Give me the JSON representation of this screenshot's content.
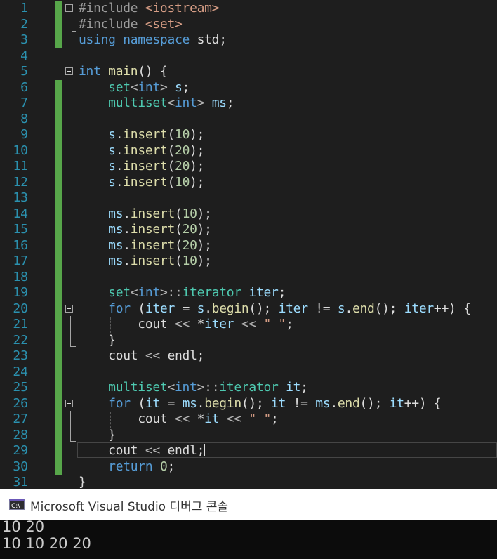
{
  "editor": {
    "line_numbers": [
      "1",
      "2",
      "3",
      "4",
      "5",
      "6",
      "7",
      "8",
      "9",
      "10",
      "11",
      "12",
      "13",
      "14",
      "15",
      "16",
      "17",
      "18",
      "19",
      "20",
      "21",
      "22",
      "23",
      "24",
      "25",
      "26",
      "27",
      "28",
      "29",
      "30",
      "31"
    ],
    "lines": [
      [
        {
          "c": "pp",
          "t": "#include "
        },
        {
          "c": "inc",
          "t": "<iostream>"
        }
      ],
      [
        {
          "c": "pp",
          "t": "#include "
        },
        {
          "c": "inc",
          "t": "<set>"
        }
      ],
      [
        {
          "c": "kw",
          "t": "using namespace "
        },
        {
          "c": "",
          "t": "std;"
        }
      ],
      [],
      [
        {
          "c": "kw",
          "t": "int "
        },
        {
          "c": "fn",
          "t": "main"
        },
        {
          "c": "",
          "t": "() {"
        }
      ],
      [
        {
          "c": "",
          "t": "    "
        },
        {
          "c": "typ",
          "t": "set"
        },
        {
          "c": "op",
          "t": "<"
        },
        {
          "c": "kw",
          "t": "int"
        },
        {
          "c": "op",
          "t": ">"
        },
        {
          "c": "",
          "t": " "
        },
        {
          "c": "var",
          "t": "s"
        },
        {
          "c": "",
          "t": ";"
        }
      ],
      [
        {
          "c": "",
          "t": "    "
        },
        {
          "c": "typ",
          "t": "multiset"
        },
        {
          "c": "op",
          "t": "<"
        },
        {
          "c": "kw",
          "t": "int"
        },
        {
          "c": "op",
          "t": ">"
        },
        {
          "c": "",
          "t": " "
        },
        {
          "c": "var",
          "t": "ms"
        },
        {
          "c": "",
          "t": ";"
        }
      ],
      [],
      [
        {
          "c": "",
          "t": "    "
        },
        {
          "c": "var",
          "t": "s"
        },
        {
          "c": "",
          "t": "."
        },
        {
          "c": "fn",
          "t": "insert"
        },
        {
          "c": "",
          "t": "("
        },
        {
          "c": "num",
          "t": "10"
        },
        {
          "c": "",
          "t": ");"
        }
      ],
      [
        {
          "c": "",
          "t": "    "
        },
        {
          "c": "var",
          "t": "s"
        },
        {
          "c": "",
          "t": "."
        },
        {
          "c": "fn",
          "t": "insert"
        },
        {
          "c": "",
          "t": "("
        },
        {
          "c": "num",
          "t": "20"
        },
        {
          "c": "",
          "t": ");"
        }
      ],
      [
        {
          "c": "",
          "t": "    "
        },
        {
          "c": "var",
          "t": "s"
        },
        {
          "c": "",
          "t": "."
        },
        {
          "c": "fn",
          "t": "insert"
        },
        {
          "c": "",
          "t": "("
        },
        {
          "c": "num",
          "t": "20"
        },
        {
          "c": "",
          "t": ");"
        }
      ],
      [
        {
          "c": "",
          "t": "    "
        },
        {
          "c": "var",
          "t": "s"
        },
        {
          "c": "",
          "t": "."
        },
        {
          "c": "fn",
          "t": "insert"
        },
        {
          "c": "",
          "t": "("
        },
        {
          "c": "num",
          "t": "10"
        },
        {
          "c": "",
          "t": ");"
        }
      ],
      [],
      [
        {
          "c": "",
          "t": "    "
        },
        {
          "c": "var",
          "t": "ms"
        },
        {
          "c": "",
          "t": "."
        },
        {
          "c": "fn",
          "t": "insert"
        },
        {
          "c": "",
          "t": "("
        },
        {
          "c": "num",
          "t": "10"
        },
        {
          "c": "",
          "t": ");"
        }
      ],
      [
        {
          "c": "",
          "t": "    "
        },
        {
          "c": "var",
          "t": "ms"
        },
        {
          "c": "",
          "t": "."
        },
        {
          "c": "fn",
          "t": "insert"
        },
        {
          "c": "",
          "t": "("
        },
        {
          "c": "num",
          "t": "20"
        },
        {
          "c": "",
          "t": ");"
        }
      ],
      [
        {
          "c": "",
          "t": "    "
        },
        {
          "c": "var",
          "t": "ms"
        },
        {
          "c": "",
          "t": "."
        },
        {
          "c": "fn",
          "t": "insert"
        },
        {
          "c": "",
          "t": "("
        },
        {
          "c": "num",
          "t": "20"
        },
        {
          "c": "",
          "t": ");"
        }
      ],
      [
        {
          "c": "",
          "t": "    "
        },
        {
          "c": "var",
          "t": "ms"
        },
        {
          "c": "",
          "t": "."
        },
        {
          "c": "fn",
          "t": "insert"
        },
        {
          "c": "",
          "t": "("
        },
        {
          "c": "num",
          "t": "10"
        },
        {
          "c": "",
          "t": ");"
        }
      ],
      [],
      [
        {
          "c": "",
          "t": "    "
        },
        {
          "c": "typ",
          "t": "set"
        },
        {
          "c": "op",
          "t": "<"
        },
        {
          "c": "kw",
          "t": "int"
        },
        {
          "c": "op",
          "t": ">::"
        },
        {
          "c": "typ",
          "t": "iterator"
        },
        {
          "c": "",
          "t": " "
        },
        {
          "c": "var",
          "t": "iter"
        },
        {
          "c": "",
          "t": ";"
        }
      ],
      [
        {
          "c": "",
          "t": "    "
        },
        {
          "c": "kw",
          "t": "for"
        },
        {
          "c": "",
          "t": " ("
        },
        {
          "c": "var",
          "t": "iter"
        },
        {
          "c": "",
          "t": " = "
        },
        {
          "c": "var",
          "t": "s"
        },
        {
          "c": "",
          "t": "."
        },
        {
          "c": "fn",
          "t": "begin"
        },
        {
          "c": "",
          "t": "(); "
        },
        {
          "c": "var",
          "t": "iter"
        },
        {
          "c": "",
          "t": " != "
        },
        {
          "c": "var",
          "t": "s"
        },
        {
          "c": "",
          "t": "."
        },
        {
          "c": "fn",
          "t": "end"
        },
        {
          "c": "",
          "t": "(); "
        },
        {
          "c": "var",
          "t": "iter"
        },
        {
          "c": "",
          "t": "++) {"
        }
      ],
      [
        {
          "c": "",
          "t": "        cout "
        },
        {
          "c": "op",
          "t": "<<"
        },
        {
          "c": "",
          "t": " *"
        },
        {
          "c": "var",
          "t": "iter"
        },
        {
          "c": "",
          "t": " "
        },
        {
          "c": "op",
          "t": "<<"
        },
        {
          "c": "",
          "t": " "
        },
        {
          "c": "str",
          "t": "\" \""
        },
        {
          "c": "",
          "t": ";"
        }
      ],
      [
        {
          "c": "",
          "t": "    }"
        }
      ],
      [
        {
          "c": "",
          "t": "    cout "
        },
        {
          "c": "op",
          "t": "<<"
        },
        {
          "c": "",
          "t": " endl;"
        }
      ],
      [],
      [
        {
          "c": "",
          "t": "    "
        },
        {
          "c": "typ",
          "t": "multiset"
        },
        {
          "c": "op",
          "t": "<"
        },
        {
          "c": "kw",
          "t": "int"
        },
        {
          "c": "op",
          "t": ">::"
        },
        {
          "c": "typ",
          "t": "iterator"
        },
        {
          "c": "",
          "t": " "
        },
        {
          "c": "var",
          "t": "it"
        },
        {
          "c": "",
          "t": ";"
        }
      ],
      [
        {
          "c": "",
          "t": "    "
        },
        {
          "c": "kw",
          "t": "for"
        },
        {
          "c": "",
          "t": " ("
        },
        {
          "c": "var",
          "t": "it"
        },
        {
          "c": "",
          "t": " = "
        },
        {
          "c": "var",
          "t": "ms"
        },
        {
          "c": "",
          "t": "."
        },
        {
          "c": "fn",
          "t": "begin"
        },
        {
          "c": "",
          "t": "(); "
        },
        {
          "c": "var",
          "t": "it"
        },
        {
          "c": "",
          "t": " != "
        },
        {
          "c": "var",
          "t": "ms"
        },
        {
          "c": "",
          "t": "."
        },
        {
          "c": "fn",
          "t": "end"
        },
        {
          "c": "",
          "t": "(); "
        },
        {
          "c": "var",
          "t": "it"
        },
        {
          "c": "",
          "t": "++) {"
        }
      ],
      [
        {
          "c": "",
          "t": "        cout "
        },
        {
          "c": "op",
          "t": "<<"
        },
        {
          "c": "",
          "t": " *"
        },
        {
          "c": "var",
          "t": "it"
        },
        {
          "c": "",
          "t": " "
        },
        {
          "c": "op",
          "t": "<<"
        },
        {
          "c": "",
          "t": " "
        },
        {
          "c": "str",
          "t": "\" \""
        },
        {
          "c": "",
          "t": ";"
        }
      ],
      [
        {
          "c": "",
          "t": "    }"
        }
      ],
      [
        {
          "c": "",
          "t": "    cout "
        },
        {
          "c": "op",
          "t": "<<"
        },
        {
          "c": "",
          "t": " endl;"
        }
      ],
      [
        {
          "c": "",
          "t": "    "
        },
        {
          "c": "kw",
          "t": "return"
        },
        {
          "c": "",
          "t": " "
        },
        {
          "c": "num",
          "t": "0"
        },
        {
          "c": "",
          "t": ";"
        }
      ],
      [
        {
          "c": "",
          "t": "}"
        }
      ]
    ],
    "changed_lines": [
      1,
      2,
      3,
      6,
      7,
      8,
      9,
      10,
      11,
      12,
      13,
      14,
      15,
      16,
      17,
      18,
      19,
      20,
      21,
      22,
      23,
      24,
      25,
      26,
      27,
      28,
      29,
      30
    ],
    "fold_lines": [
      1,
      5,
      20,
      26
    ],
    "current_line": 29,
    "colors": {
      "background": "#1e1e1e",
      "line_number": "#2b91af",
      "change_bar": "#57a64a",
      "keyword": "#569cd6",
      "type": "#4ec9b0",
      "variable": "#9cdcfe",
      "function": "#dcdcaa",
      "number": "#b5cea8",
      "string": "#d69d85"
    }
  },
  "console": {
    "icon": "console-app-icon",
    "title": "Microsoft Visual Studio 디버그 콘솔",
    "output": [
      "10 20",
      "10 10 20 20"
    ]
  }
}
